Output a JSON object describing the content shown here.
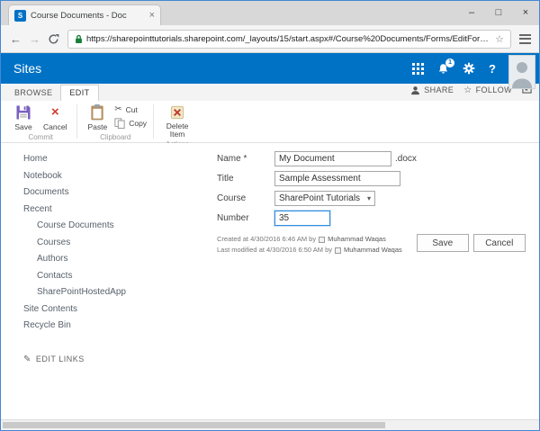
{
  "colors": {
    "suite_bar": "#0072c6",
    "accent": "#0072c6"
  },
  "browser": {
    "tab_title": "Course Documents - Doc",
    "url": "https://sharepointtutorials.sharepoint.com/_layouts/15/start.aspx#/Course%20Documents/Forms/EditForm.aspx?I"
  },
  "icons": {
    "favicon_letter": "S",
    "close_tab": "×",
    "minimize": "–",
    "maximize": "□",
    "close_window": "×",
    "back": "←",
    "forward": "→",
    "bookmark_star": "☆",
    "follow_star": "☆",
    "cut": "✂",
    "cancel_x": "×",
    "edit_links_pencil": "✎",
    "dropdown_arrow": "▾"
  },
  "suite": {
    "title": "Sites",
    "notification_badge": "1",
    "help": "?"
  },
  "ribbon": {
    "tabs": [
      "BROWSE",
      "EDIT"
    ],
    "share": "SHARE",
    "follow": "FOLLOW",
    "buttons": {
      "save": "Save",
      "cancel": "Cancel",
      "paste": "Paste",
      "cut": "Cut",
      "copy": "Copy",
      "delete_item": "Delete Item"
    },
    "groups": {
      "commit": "Commit",
      "clipboard": "Clipboard",
      "actions": "Actions"
    }
  },
  "sidebar": {
    "items": [
      "Home",
      "Notebook",
      "Documents",
      "Recent",
      "Course Documents",
      "Courses",
      "Authors",
      "Contacts",
      "SharePointHostedApp",
      "Site Contents",
      "Recycle Bin"
    ],
    "edit_links": "EDIT LINKS"
  },
  "form": {
    "name_label": "Name *",
    "name_value": "My Document",
    "name_suffix": ".docx",
    "title_label": "Title",
    "title_value": "Sample Assessment",
    "course_label": "Course",
    "course_value": "SharePoint Tutorials",
    "number_label": "Number",
    "number_value": "35",
    "created": "Created at 4/30/2016 6:46 AM  by",
    "created_by": "Muhammad Waqas",
    "modified": "Last modified at 4/30/2016 6:50 AM  by",
    "modified_by": "Muhammad Waqas",
    "save": "Save",
    "cancel": "Cancel"
  }
}
